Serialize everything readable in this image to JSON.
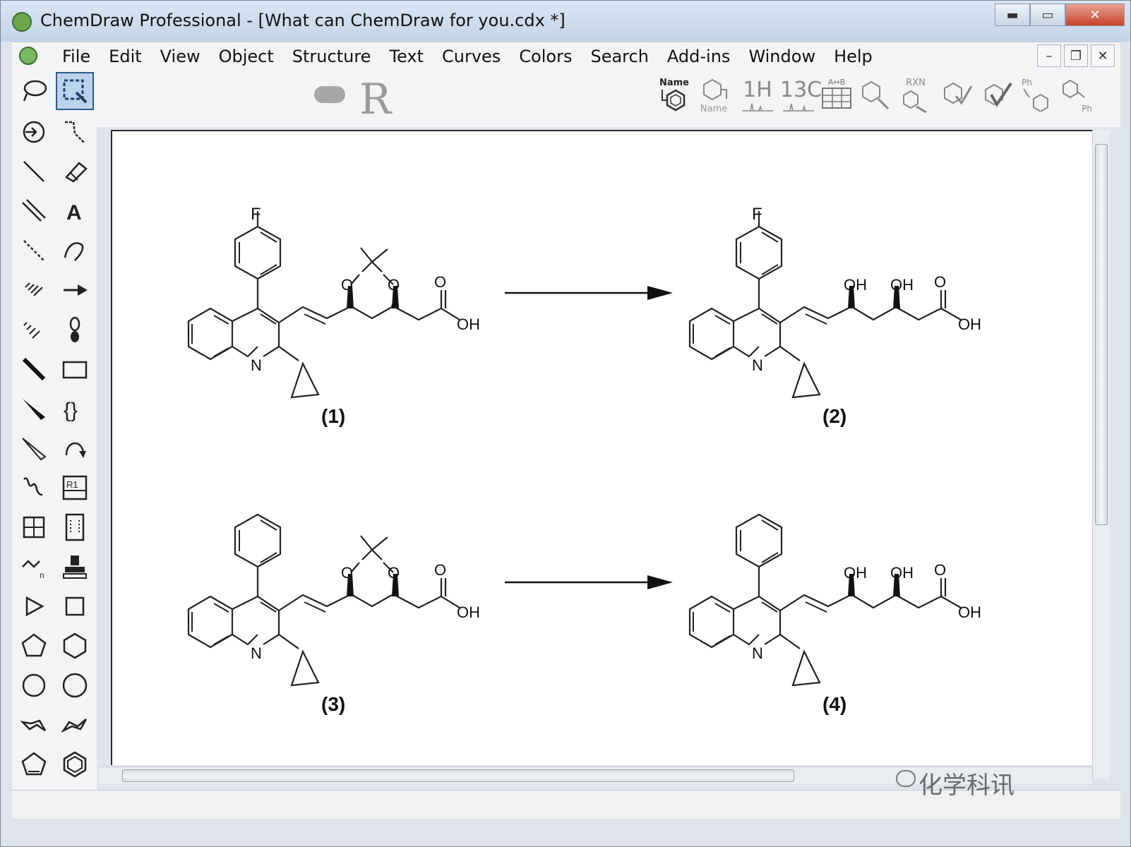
{
  "window": {
    "title": "ChemDraw Professional - [What can ChemDraw for you.cdx *]",
    "controls": {
      "minimize": "▬",
      "maximize": "▭",
      "close": "✕"
    }
  },
  "menubar": {
    "items": [
      "File",
      "Edit",
      "View",
      "Object",
      "Structure",
      "Text",
      "Curves",
      "Colors",
      "Search",
      "Add-ins",
      "Window",
      "Help"
    ],
    "mdi_controls": {
      "minimize": "–",
      "restore": "❐",
      "close": "✕"
    }
  },
  "toolbar": {
    "r_label": "R",
    "buttons": [
      {
        "name": "name-to-structure",
        "label": "Name"
      },
      {
        "name": "structure-to-name",
        "label": "Name"
      },
      {
        "name": "predict-1h-nmr",
        "label": "1H"
      },
      {
        "name": "predict-13c-nmr",
        "label": "13C"
      },
      {
        "name": "compare-structures",
        "label": "A↔B"
      },
      {
        "name": "clean-structure",
        "label": ""
      },
      {
        "name": "reaction-interpreter",
        "label": "RXN"
      },
      {
        "name": "check-structure",
        "label": ""
      },
      {
        "name": "check-stereo",
        "label": ""
      },
      {
        "name": "expand-label-ph",
        "label": "Ph"
      },
      {
        "name": "contract-label-ph",
        "label": "Ph"
      }
    ]
  },
  "canvas": {
    "compounds": [
      {
        "id": "1",
        "label": "(1)",
        "substituent": "F",
        "protected": true
      },
      {
        "id": "2",
        "label": "(2)",
        "substituent": "F",
        "protected": false
      },
      {
        "id": "3",
        "label": "(3)",
        "substituent": "",
        "protected": true
      },
      {
        "id": "4",
        "label": "(4)",
        "substituent": "",
        "protected": false
      }
    ],
    "atom_labels": {
      "N": "N",
      "O": "O",
      "OH": "OH",
      "F": "F"
    }
  },
  "watermark": "化学科讯",
  "colors": {
    "titlebar": "#c3d3e8",
    "selected_tool": "#bcd3ec",
    "close_button": "#c9402a"
  }
}
